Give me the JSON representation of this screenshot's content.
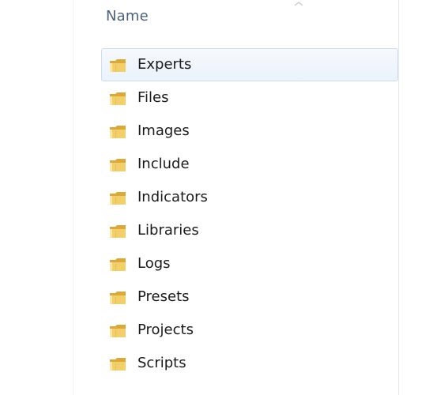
{
  "explorer": {
    "column_header": "Name",
    "sort_icon": "sort-arrow-icon",
    "folder_icon": "folder-icon",
    "selected_index": 0,
    "colors": {
      "header_text": "#4c607a",
      "item_text": "#1a1a1a",
      "selection_border": "#cfdcec",
      "selection_fill": "#eaf2fb",
      "folder_front": "#f2cf6b",
      "folder_back": "#d9a93c"
    },
    "items": [
      {
        "name": "Experts",
        "type": "folder"
      },
      {
        "name": "Files",
        "type": "folder"
      },
      {
        "name": "Images",
        "type": "folder"
      },
      {
        "name": "Include",
        "type": "folder"
      },
      {
        "name": "Indicators",
        "type": "folder"
      },
      {
        "name": "Libraries",
        "type": "folder"
      },
      {
        "name": "Logs",
        "type": "folder"
      },
      {
        "name": "Presets",
        "type": "folder"
      },
      {
        "name": "Projects",
        "type": "folder"
      },
      {
        "name": "Scripts",
        "type": "folder"
      }
    ]
  }
}
